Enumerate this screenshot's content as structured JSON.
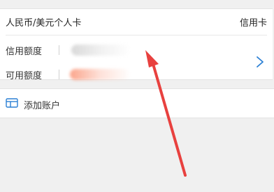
{
  "card": {
    "currency_type": "人民币/美元个人卡",
    "card_type": "信用卡",
    "credit_limit_label": "信用额度",
    "available_limit_label": "可用额度"
  },
  "add_account": {
    "label": "添加账户",
    "icon": "card-add-icon"
  },
  "annotation": {
    "arrow_color": "#e8413f"
  },
  "colors": {
    "accent": "#2a7fd4",
    "background": "#f0f0f0"
  }
}
